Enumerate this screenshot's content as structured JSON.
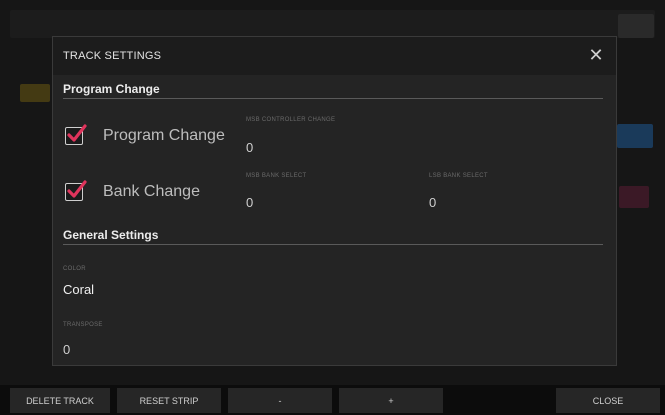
{
  "dialog": {
    "title": "TRACK SETTINGS",
    "close_glyph": "✕"
  },
  "program_change": {
    "section_title": "Program Change",
    "program_change_checkbox": {
      "label": "Program Change",
      "checked": true
    },
    "bank_change_checkbox": {
      "label": "Bank Change",
      "checked": true
    },
    "fields": [
      {
        "label": "MSB CONTROLLER CHANGE",
        "value": "0"
      },
      {
        "label": "MSB BANK SELECT",
        "value": "0"
      },
      {
        "label": "LSB BANK SELECT",
        "value": "0"
      }
    ]
  },
  "general_settings": {
    "section_title": "General Settings",
    "color": {
      "label": "COLOR",
      "value": "Coral"
    },
    "transpose": {
      "label": "TRANSPOSE",
      "value": "0"
    }
  },
  "toolbar": {
    "delete_track": "DELETE TRACK",
    "reset_strip": "RESET STRIP",
    "minus": "-",
    "plus": "+",
    "close": "CLOSE"
  },
  "colors": {
    "checkmark": "#e0345c",
    "modal_bg": "#242424",
    "header_bg": "#1c1c1c"
  }
}
